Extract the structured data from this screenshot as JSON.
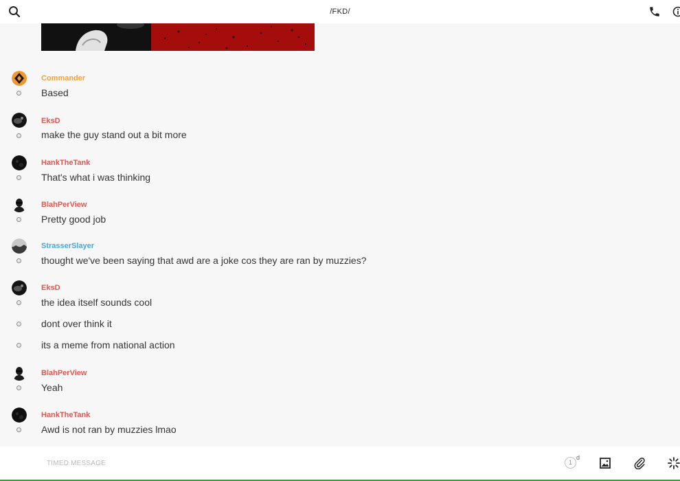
{
  "header": {
    "title": "/FKD/",
    "icons": {
      "search": "search-icon",
      "call": "phone-icon",
      "info": "info-icon"
    }
  },
  "colors": {
    "red_user": "#e0574f",
    "orange_user": "#f3a03a",
    "blue_user": "#4aa8cf",
    "banner": "#a50c0c"
  },
  "messages": [
    {
      "user": "Commander",
      "color": "orange",
      "avatar": "commander-avatar",
      "lines": [
        "Based"
      ]
    },
    {
      "user": "EksD",
      "color": "red",
      "avatar": "eksd-avatar",
      "lines": [
        "make the guy stand out a bit more"
      ]
    },
    {
      "user": "HankTheTank",
      "color": "red",
      "avatar": "hankthetank-avatar",
      "lines": [
        "That's what i was thinking"
      ]
    },
    {
      "user": "BlahPerView",
      "color": "red",
      "avatar": "blahperview-avatar",
      "lines": [
        "Pretty good job"
      ]
    },
    {
      "user": "StrasserSlayer",
      "color": "blue",
      "avatar": "strasserslayer-avatar",
      "lines": [
        "thought we've been saying that awd are a joke cos they are ran by muzzies?"
      ]
    },
    {
      "user": "EksD",
      "color": "red",
      "avatar": "eksd-avatar",
      "lines": [
        "the idea itself sounds cool",
        "dont over think it",
        "its a meme from national action"
      ]
    },
    {
      "user": "BlahPerView",
      "color": "red",
      "avatar": "blahperview-avatar",
      "lines": [
        "Yeah"
      ]
    },
    {
      "user": "HankTheTank",
      "color": "red",
      "avatar": "hankthetank-avatar",
      "lines": [
        "Awd is not ran by muzzies lmao"
      ]
    }
  ],
  "composer": {
    "placeholder": "TIMED MESSAGE",
    "timer_value": "1",
    "timer_unit": "d",
    "icons": {
      "image": "image-icon",
      "attach": "paperclip-icon",
      "sparkle": "sparkle-icon"
    }
  }
}
